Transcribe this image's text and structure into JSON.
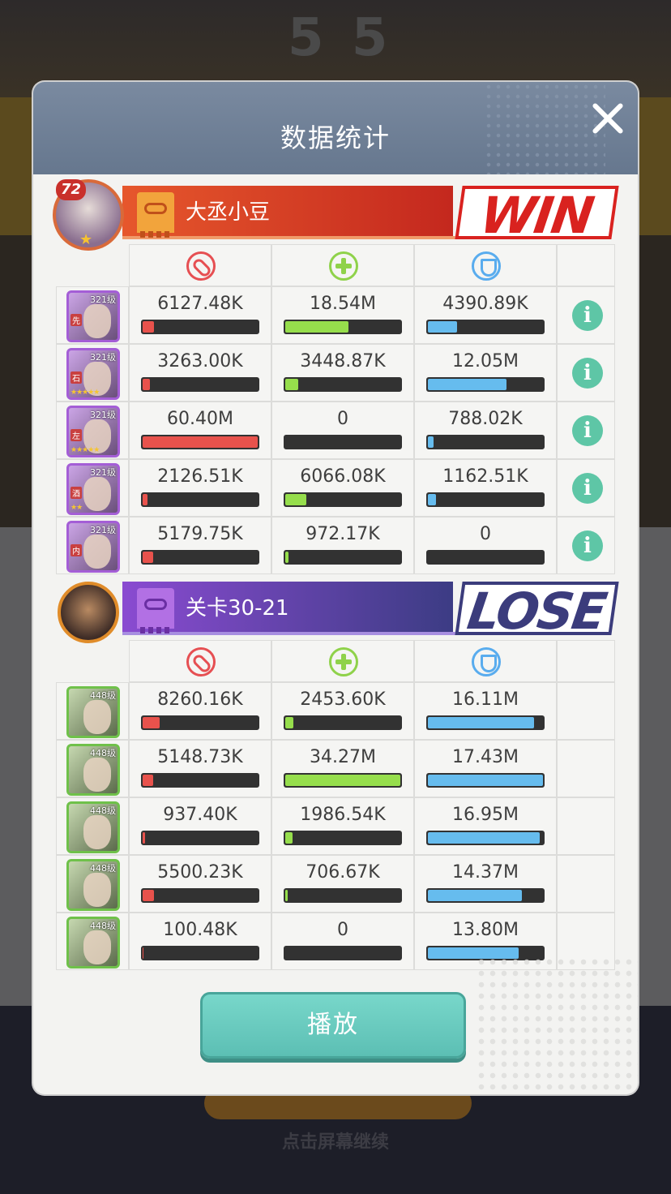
{
  "background": {
    "score": "5 5",
    "hint": "点击屏幕继续"
  },
  "modal": {
    "title": "数据统计",
    "play_button": "播放"
  },
  "teams": [
    {
      "name": "大丞小豆",
      "result": "WIN",
      "level": "72",
      "rows": [
        {
          "hero_level": "321级",
          "tag": "先",
          "damage": "6127.48K",
          "heal": "18.54M",
          "tank": "4390.89K",
          "damage_pct": 0.1,
          "heal_pct": 0.55,
          "tank_pct": 0.25,
          "stars": ""
        },
        {
          "hero_level": "321级",
          "tag": "石",
          "damage": "3263.00K",
          "heal": "3448.87K",
          "tank": "12.05M",
          "damage_pct": 0.06,
          "heal_pct": 0.11,
          "tank_pct": 0.68,
          "stars": "★★★★★"
        },
        {
          "hero_level": "321级",
          "tag": "左",
          "damage": "60.40M",
          "heal": "0",
          "tank": "788.02K",
          "damage_pct": 1.0,
          "heal_pct": 0.0,
          "tank_pct": 0.05,
          "stars": "★★★★★"
        },
        {
          "hero_level": "321级",
          "tag": "酒",
          "damage": "2126.51K",
          "heal": "6066.08K",
          "tank": "1162.51K",
          "damage_pct": 0.04,
          "heal_pct": 0.18,
          "tank_pct": 0.07,
          "stars": "★★"
        },
        {
          "hero_level": "321级",
          "tag": "内",
          "damage": "5179.75K",
          "heal": "972.17K",
          "tank": "0",
          "damage_pct": 0.09,
          "heal_pct": 0.03,
          "tank_pct": 0.0,
          "stars": ""
        }
      ]
    },
    {
      "name": "关卡30-21",
      "result": "LOSE",
      "rows": [
        {
          "hero_level": "448级",
          "damage": "8260.16K",
          "heal": "2453.60K",
          "tank": "16.11M",
          "damage_pct": 0.15,
          "heal_pct": 0.07,
          "tank_pct": 0.92
        },
        {
          "hero_level": "448级",
          "damage": "5148.73K",
          "heal": "34.27M",
          "tank": "17.43M",
          "damage_pct": 0.09,
          "heal_pct": 1.0,
          "tank_pct": 1.0
        },
        {
          "hero_level": "448级",
          "damage": "937.40K",
          "heal": "1986.54K",
          "tank": "16.95M",
          "damage_pct": 0.02,
          "heal_pct": 0.06,
          "tank_pct": 0.97
        },
        {
          "hero_level": "448级",
          "damage": "5500.23K",
          "heal": "706.67K",
          "tank": "14.37M",
          "damage_pct": 0.1,
          "heal_pct": 0.02,
          "tank_pct": 0.82
        },
        {
          "hero_level": "448级",
          "damage": "100.48K",
          "heal": "0",
          "tank": "13.80M",
          "damage_pct": 0.01,
          "heal_pct": 0.0,
          "tank_pct": 0.79
        }
      ]
    }
  ],
  "colors": {
    "damage": "#e8524c",
    "heal": "#96de4c",
    "tank": "#66bcee",
    "win": "#d9221f",
    "lose": "#3b3c7c",
    "play_button": "#6ccbbf"
  },
  "icons": {
    "damage": "sword-icon",
    "heal": "plus-icon",
    "tank": "shield-icon",
    "info": "info-icon",
    "close": "close-icon",
    "team": "banner-mask-icon"
  }
}
